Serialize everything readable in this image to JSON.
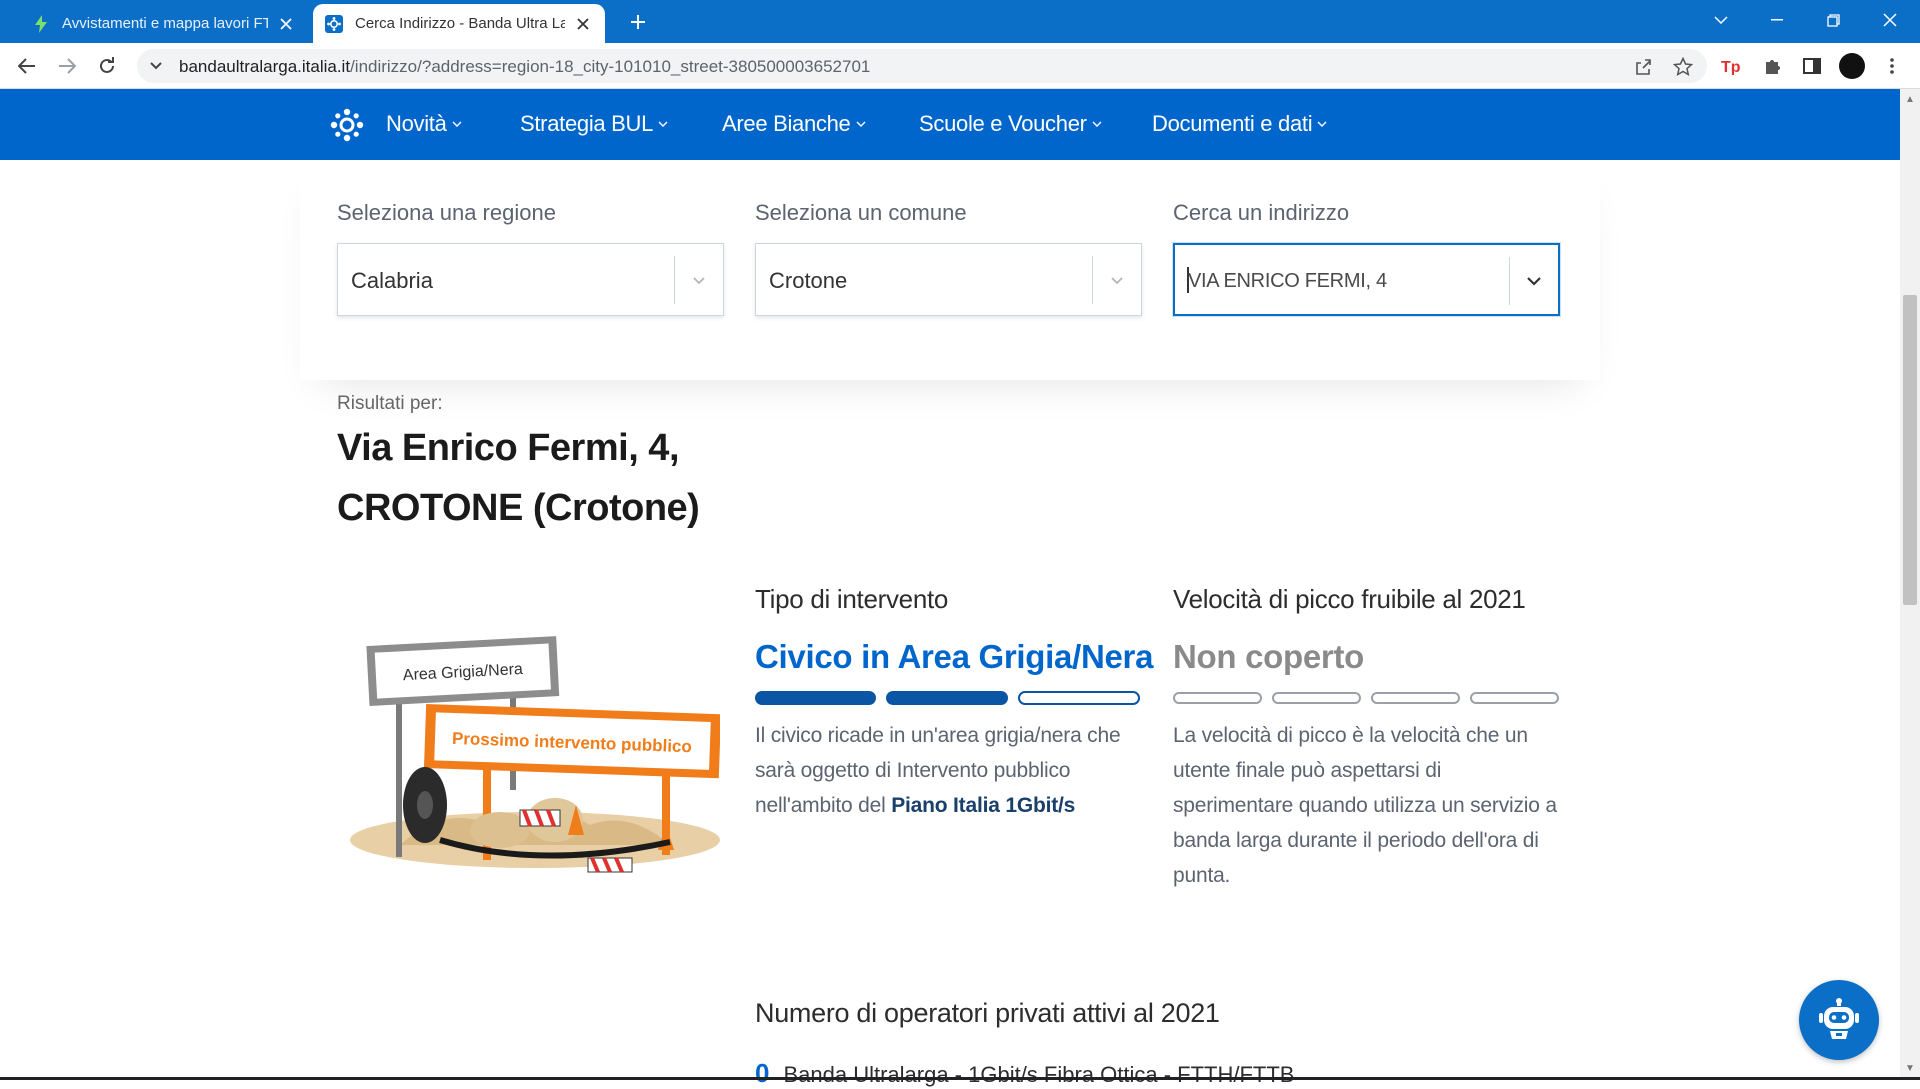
{
  "browser": {
    "tabs": [
      {
        "title": "Avvistamenti e mappa lavori FTTH",
        "active": false
      },
      {
        "title": "Cerca Indirizzo - Banda Ultra Larga",
        "active": true
      }
    ],
    "url_host": "bandaultralarga.italia.it",
    "url_path": "/indirizzo/?address=region-18_city-101010_street-380500003652701"
  },
  "nav": {
    "items": [
      "Novità",
      "Strategia BUL",
      "Aree Bianche",
      "Scuole e Voucher",
      "Documenti e dati"
    ]
  },
  "search": {
    "region_label": "Seleziona una regione",
    "region_value": "Calabria",
    "city_label": "Seleziona un comune",
    "city_value": "Crotone",
    "address_label": "Cerca un indirizzo",
    "address_value": "VIA ENRICO FERMI, 4"
  },
  "results": {
    "label": "Risultati per:",
    "address_line1": "Via Enrico Fermi, 4,",
    "address_line2": "CROTONE (Crotone)"
  },
  "illustration": {
    "sign_top": "Area Grigia/Nera",
    "sign_main": "Prossimo intervento pubblico"
  },
  "intervento": {
    "heading": "Tipo di intervento",
    "value": "Civico in Area Grigia/Nera",
    "level_filled": 2,
    "level_total": 3,
    "desc_1": "Il civico ricade in un'area grigia/nera che",
    "desc_2": "sarà oggetto di Intervento pubblico",
    "desc_3": "nell'ambito del",
    "desc_bold": "Piano Italia 1Gbit/s"
  },
  "velocita": {
    "heading": "Velocità di picco fruibile al 2021",
    "value": "Non coperto",
    "level_filled": 0,
    "level_total": 4,
    "desc_1": "La velocità di picco è la velocità che un",
    "desc_2": "utente finale può aspettarsi di",
    "desc_3": "sperimentare quando utilizza un servizio a",
    "desc_4": "banda larga durante il periodo dell'ora di",
    "desc_5": "punta."
  },
  "operatori": {
    "heading": "Numero di operatori privati attivi al 2021",
    "first_num": "0",
    "first_label": "Banda Ultralarga - 1Gbit/s Fibra Ottica - FTTH/FTTB"
  },
  "colors": {
    "brand_blue": "#0066cc",
    "tabbar_blue": "#0b6ec7",
    "bar_blue": "#0b56a4"
  },
  "icons": {
    "chatbot": "robot-icon",
    "logo": "bul-logo-icon"
  }
}
